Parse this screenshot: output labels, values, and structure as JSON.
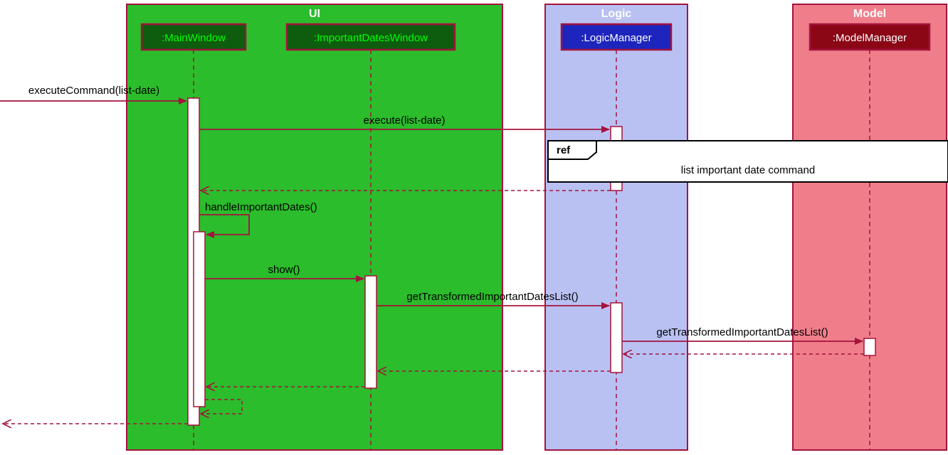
{
  "colors": {
    "ui_fill": "#2bbd2b",
    "ui_stroke": "#a5123c",
    "ui_head_fill": "#0e5d0e",
    "logic_fill": "#b9c1f3",
    "logic_head_fill": "#1d25bd",
    "model_fill": "#ef7e8a",
    "model_head_fill": "#8b0716",
    "line": "#a5123c",
    "activation_fill": "#ffffff",
    "ref_fill": "#ffffff",
    "text_dark": "#000000",
    "text_light": "#ffffff",
    "ui_text": "#00ff00"
  },
  "packages": {
    "ui": "UI",
    "logic": "Logic",
    "model": "Model"
  },
  "lifelines": {
    "main_window": ":MainWindow",
    "important_dates_window": ":ImportantDatesWindow",
    "logic_manager": ":LogicManager",
    "model_manager": ":ModelManager"
  },
  "messages": {
    "execute_command": "executeCommand(list-date)",
    "execute": "execute(list-date)",
    "handle_important_dates": "handleImportantDates()",
    "show": "show()",
    "get_transformed_1": "getTransformedImportantDatesList()",
    "get_transformed_2": "getTransformedImportantDatesList()"
  },
  "ref": {
    "tag": "ref",
    "text": "list important date command"
  },
  "chart_data": {
    "type": "sequence",
    "packages": [
      {
        "name": "UI",
        "lifelines": [
          "MainWindow",
          "ImportantDatesWindow"
        ]
      },
      {
        "name": "Logic",
        "lifelines": [
          "LogicManager"
        ]
      },
      {
        "name": "Model",
        "lifelines": [
          "ModelManager"
        ]
      }
    ],
    "events": [
      {
        "from": "external",
        "to": "MainWindow",
        "label": "executeCommand(list-date)",
        "sync": true
      },
      {
        "from": "MainWindow",
        "to": "LogicManager",
        "label": "execute(list-date)",
        "sync": true
      },
      {
        "type": "ref",
        "over": [
          "LogicManager",
          "ModelManager"
        ],
        "text": "list important date command"
      },
      {
        "from": "LogicManager",
        "to": "MainWindow",
        "label": "",
        "return": true
      },
      {
        "from": "MainWindow",
        "to": "MainWindow",
        "label": "handleImportantDates()",
        "sync": true
      },
      {
        "from": "MainWindow",
        "to": "ImportantDatesWindow",
        "label": "show()",
        "sync": true
      },
      {
        "from": "ImportantDatesWindow",
        "to": "LogicManager",
        "label": "getTransformedImportantDatesList()",
        "sync": true
      },
      {
        "from": "LogicManager",
        "to": "ModelManager",
        "label": "getTransformedImportantDatesList()",
        "sync": true
      },
      {
        "from": "ModelManager",
        "to": "LogicManager",
        "label": "",
        "return": true
      },
      {
        "from": "LogicManager",
        "to": "ImportantDatesWindow",
        "label": "",
        "return": true
      },
      {
        "from": "ImportantDatesWindow",
        "to": "MainWindow",
        "label": "",
        "return": true
      },
      {
        "from": "MainWindow",
        "to": "MainWindow",
        "label": "",
        "return": true,
        "self": true
      },
      {
        "from": "MainWindow",
        "to": "external",
        "label": "",
        "return": true
      }
    ]
  }
}
